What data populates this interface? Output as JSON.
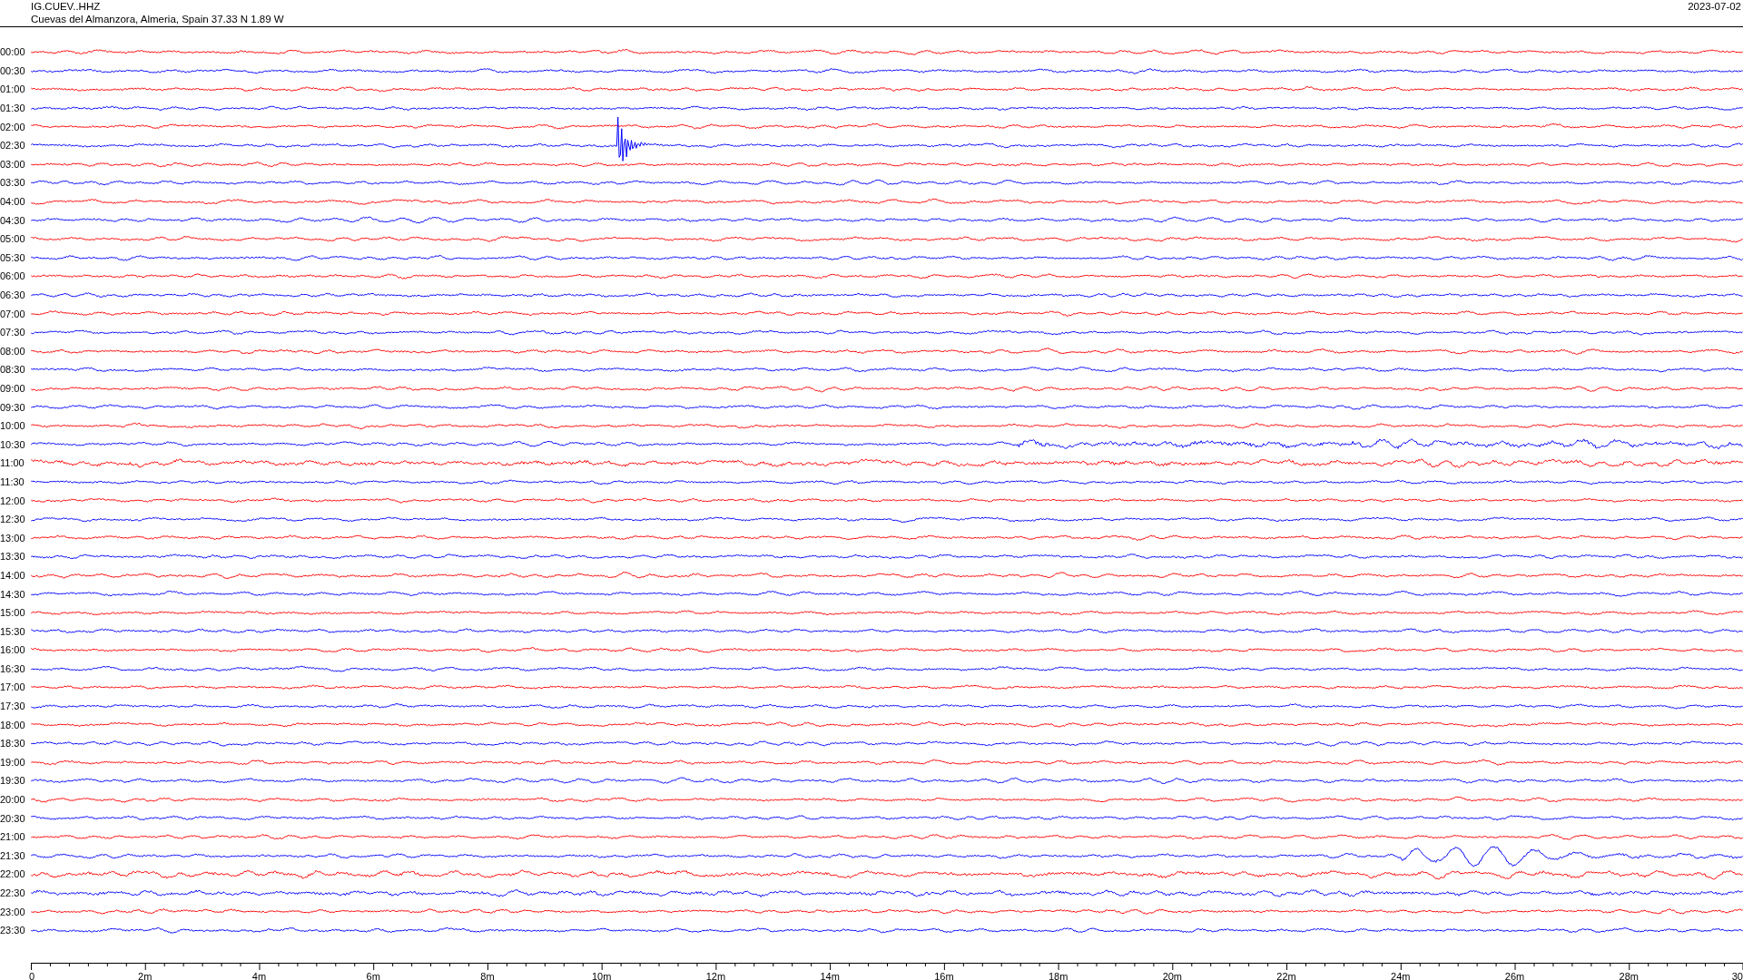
{
  "header": {
    "station": "IG.CUEV..HHZ",
    "location": "Cuevas del Almanzora, Almeria, Spain  37.33 N 1.89 W",
    "date": "2023-07-02"
  },
  "rows": [
    {
      "time": "00:00",
      "color": "#ff0000"
    },
    {
      "time": "00:30",
      "color": "#0000ff"
    },
    {
      "time": "01:00",
      "color": "#ff0000"
    },
    {
      "time": "01:30",
      "color": "#0000ff"
    },
    {
      "time": "02:00",
      "color": "#ff0000"
    },
    {
      "time": "02:30",
      "color": "#0000ff"
    },
    {
      "time": "03:00",
      "color": "#ff0000"
    },
    {
      "time": "03:30",
      "color": "#0000ff"
    },
    {
      "time": "04:00",
      "color": "#ff0000"
    },
    {
      "time": "04:30",
      "color": "#0000ff"
    },
    {
      "time": "05:00",
      "color": "#ff0000"
    },
    {
      "time": "05:30",
      "color": "#0000ff"
    },
    {
      "time": "06:00",
      "color": "#ff0000"
    },
    {
      "time": "06:30",
      "color": "#0000ff"
    },
    {
      "time": "07:00",
      "color": "#ff0000"
    },
    {
      "time": "07:30",
      "color": "#0000ff"
    },
    {
      "time": "08:00",
      "color": "#ff0000"
    },
    {
      "time": "08:30",
      "color": "#0000ff"
    },
    {
      "time": "09:00",
      "color": "#ff0000"
    },
    {
      "time": "09:30",
      "color": "#0000ff"
    },
    {
      "time": "10:00",
      "color": "#ff0000"
    },
    {
      "time": "10:30",
      "color": "#0000ff"
    },
    {
      "time": "11:00",
      "color": "#ff0000"
    },
    {
      "time": "11:30",
      "color": "#0000ff"
    },
    {
      "time": "12:00",
      "color": "#ff0000"
    },
    {
      "time": "12:30",
      "color": "#0000ff"
    },
    {
      "time": "13:00",
      "color": "#ff0000"
    },
    {
      "time": "13:30",
      "color": "#0000ff"
    },
    {
      "time": "14:00",
      "color": "#ff0000"
    },
    {
      "time": "14:30",
      "color": "#0000ff"
    },
    {
      "time": "15:00",
      "color": "#ff0000"
    },
    {
      "time": "15:30",
      "color": "#0000ff"
    },
    {
      "time": "16:00",
      "color": "#ff0000"
    },
    {
      "time": "16:30",
      "color": "#0000ff"
    },
    {
      "time": "17:00",
      "color": "#ff0000"
    },
    {
      "time": "17:30",
      "color": "#0000ff"
    },
    {
      "time": "18:00",
      "color": "#ff0000"
    },
    {
      "time": "18:30",
      "color": "#0000ff"
    },
    {
      "time": "19:00",
      "color": "#ff0000"
    },
    {
      "time": "19:30",
      "color": "#0000ff"
    },
    {
      "time": "20:00",
      "color": "#ff0000"
    },
    {
      "time": "20:30",
      "color": "#0000ff"
    },
    {
      "time": "21:00",
      "color": "#ff0000"
    },
    {
      "time": "21:30",
      "color": "#0000ff"
    },
    {
      "time": "22:00",
      "color": "#ff0000"
    },
    {
      "time": "22:30",
      "color": "#0000ff"
    },
    {
      "time": "23:00",
      "color": "#ff0000"
    },
    {
      "time": "23:30",
      "color": "#0000ff"
    }
  ],
  "axis": {
    "ticks": [
      "0",
      "2m",
      "4m",
      "6m",
      "8m",
      "10m",
      "12m",
      "14m",
      "16m",
      "18m",
      "20m",
      "22m",
      "24m",
      "26m",
      "28m",
      "30"
    ]
  }
}
